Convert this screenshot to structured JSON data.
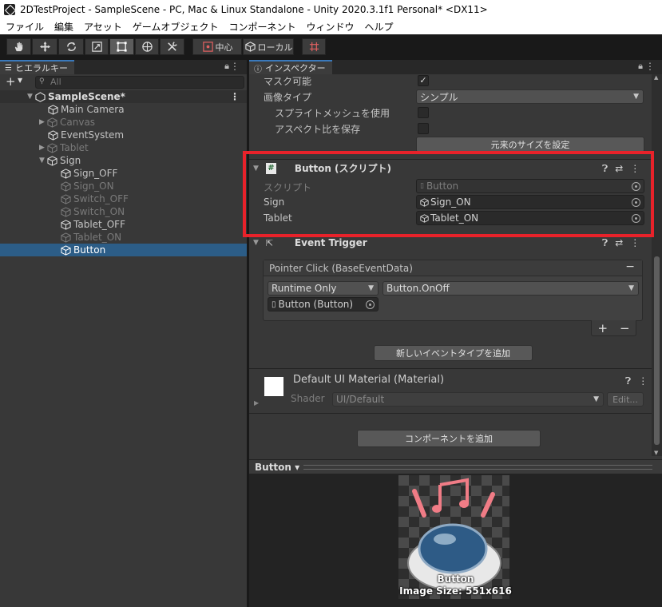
{
  "window": {
    "title": "2DTestProject - SampleScene - PC, Mac & Linux Standalone - Unity 2020.3.1f1 Personal* <DX11>"
  },
  "menu": [
    "ファイル",
    "編集",
    "アセット",
    "ゲームオブジェクト",
    "コンポーネント",
    "ウィンドウ",
    "ヘルプ"
  ],
  "toolbar": {
    "pivot_label": "中心",
    "space_label": "ローカル"
  },
  "hierarchy": {
    "tab_label": "ヒエラルキー",
    "add_label": "+",
    "search_placeholder": "All",
    "scene_name": "SampleScene*",
    "items": [
      {
        "label": "Main Camera"
      },
      {
        "label": "Canvas"
      },
      {
        "label": "EventSystem"
      },
      {
        "label": "Tablet"
      },
      {
        "label": "Sign"
      },
      {
        "label": "Sign_OFF"
      },
      {
        "label": "Sign_ON"
      },
      {
        "label": "Switch_OFF"
      },
      {
        "label": "Switch_ON"
      },
      {
        "label": "Tablet_OFF"
      },
      {
        "label": "Tablet_ON"
      },
      {
        "label": "Button"
      }
    ]
  },
  "inspector": {
    "tab_label": "インスペクター",
    "image": {
      "maskable_label": "マスク可能",
      "image_type_label": "画像タイプ",
      "image_type_value": "シンプル",
      "use_sprite_mesh_label": "スプライトメッシュを使用",
      "preserve_aspect_label": "アスペクト比を保存",
      "set_native_size_label": "元来のサイズを設定"
    },
    "button_script": {
      "title": "Button (スクリプト)",
      "script_label": "スクリプト",
      "script_value": "Button",
      "sign_label": "Sign",
      "sign_value": "Sign_ON",
      "tablet_label": "Tablet",
      "tablet_value": "Tablet_ON"
    },
    "event_trigger": {
      "title": "Event Trigger",
      "entry_title": "Pointer Click (BaseEventData)",
      "runtime_value": "Runtime Only",
      "function_value": "Button.OnOff",
      "object_value": "Button (Button)",
      "add_event_label": "新しいイベントタイプを追加",
      "plus_label": "+",
      "minus_label": "−",
      "remove_entry_label": "−"
    },
    "material": {
      "title": "Default UI Material (Material)",
      "shader_label": "Shader",
      "shader_value": "UI/Default",
      "edit_label": "Edit..."
    },
    "add_component_label": "コンポーネントを追加",
    "preview": {
      "header_label": "Button ▾",
      "name": "Button",
      "size_text": "Image Size: 551x616"
    }
  }
}
